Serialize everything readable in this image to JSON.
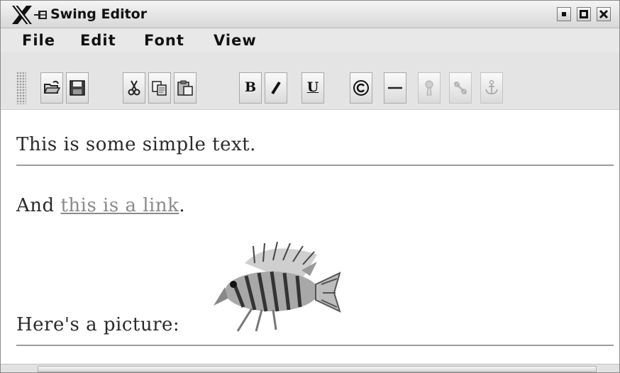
{
  "window": {
    "title": "Swing Editor",
    "controls": [
      "minimize",
      "maximize",
      "close"
    ]
  },
  "menu": {
    "items": [
      "File",
      "Edit",
      "Font",
      "View"
    ]
  },
  "toolbar": {
    "groups": [
      [
        "open-icon",
        "save-icon"
      ],
      [
        "cut-icon",
        "copy-icon",
        "paste-icon"
      ],
      [
        "bold",
        "italic",
        "underline"
      ],
      [
        "copyright-icon",
        "horizontal-rule-icon",
        "insert-image-icon",
        "insert-link-icon",
        "insert-anchor-icon"
      ]
    ],
    "bold_label": "B",
    "underline_label": "U"
  },
  "document": {
    "line1": "This is some simple text.",
    "line2_prefix": "And ",
    "line2_link": "this is a link",
    "line2_suffix": ".",
    "line3": "Here's a picture:"
  },
  "colors": {
    "link": "#8a8a8a",
    "rule": "#9c9c9c"
  }
}
